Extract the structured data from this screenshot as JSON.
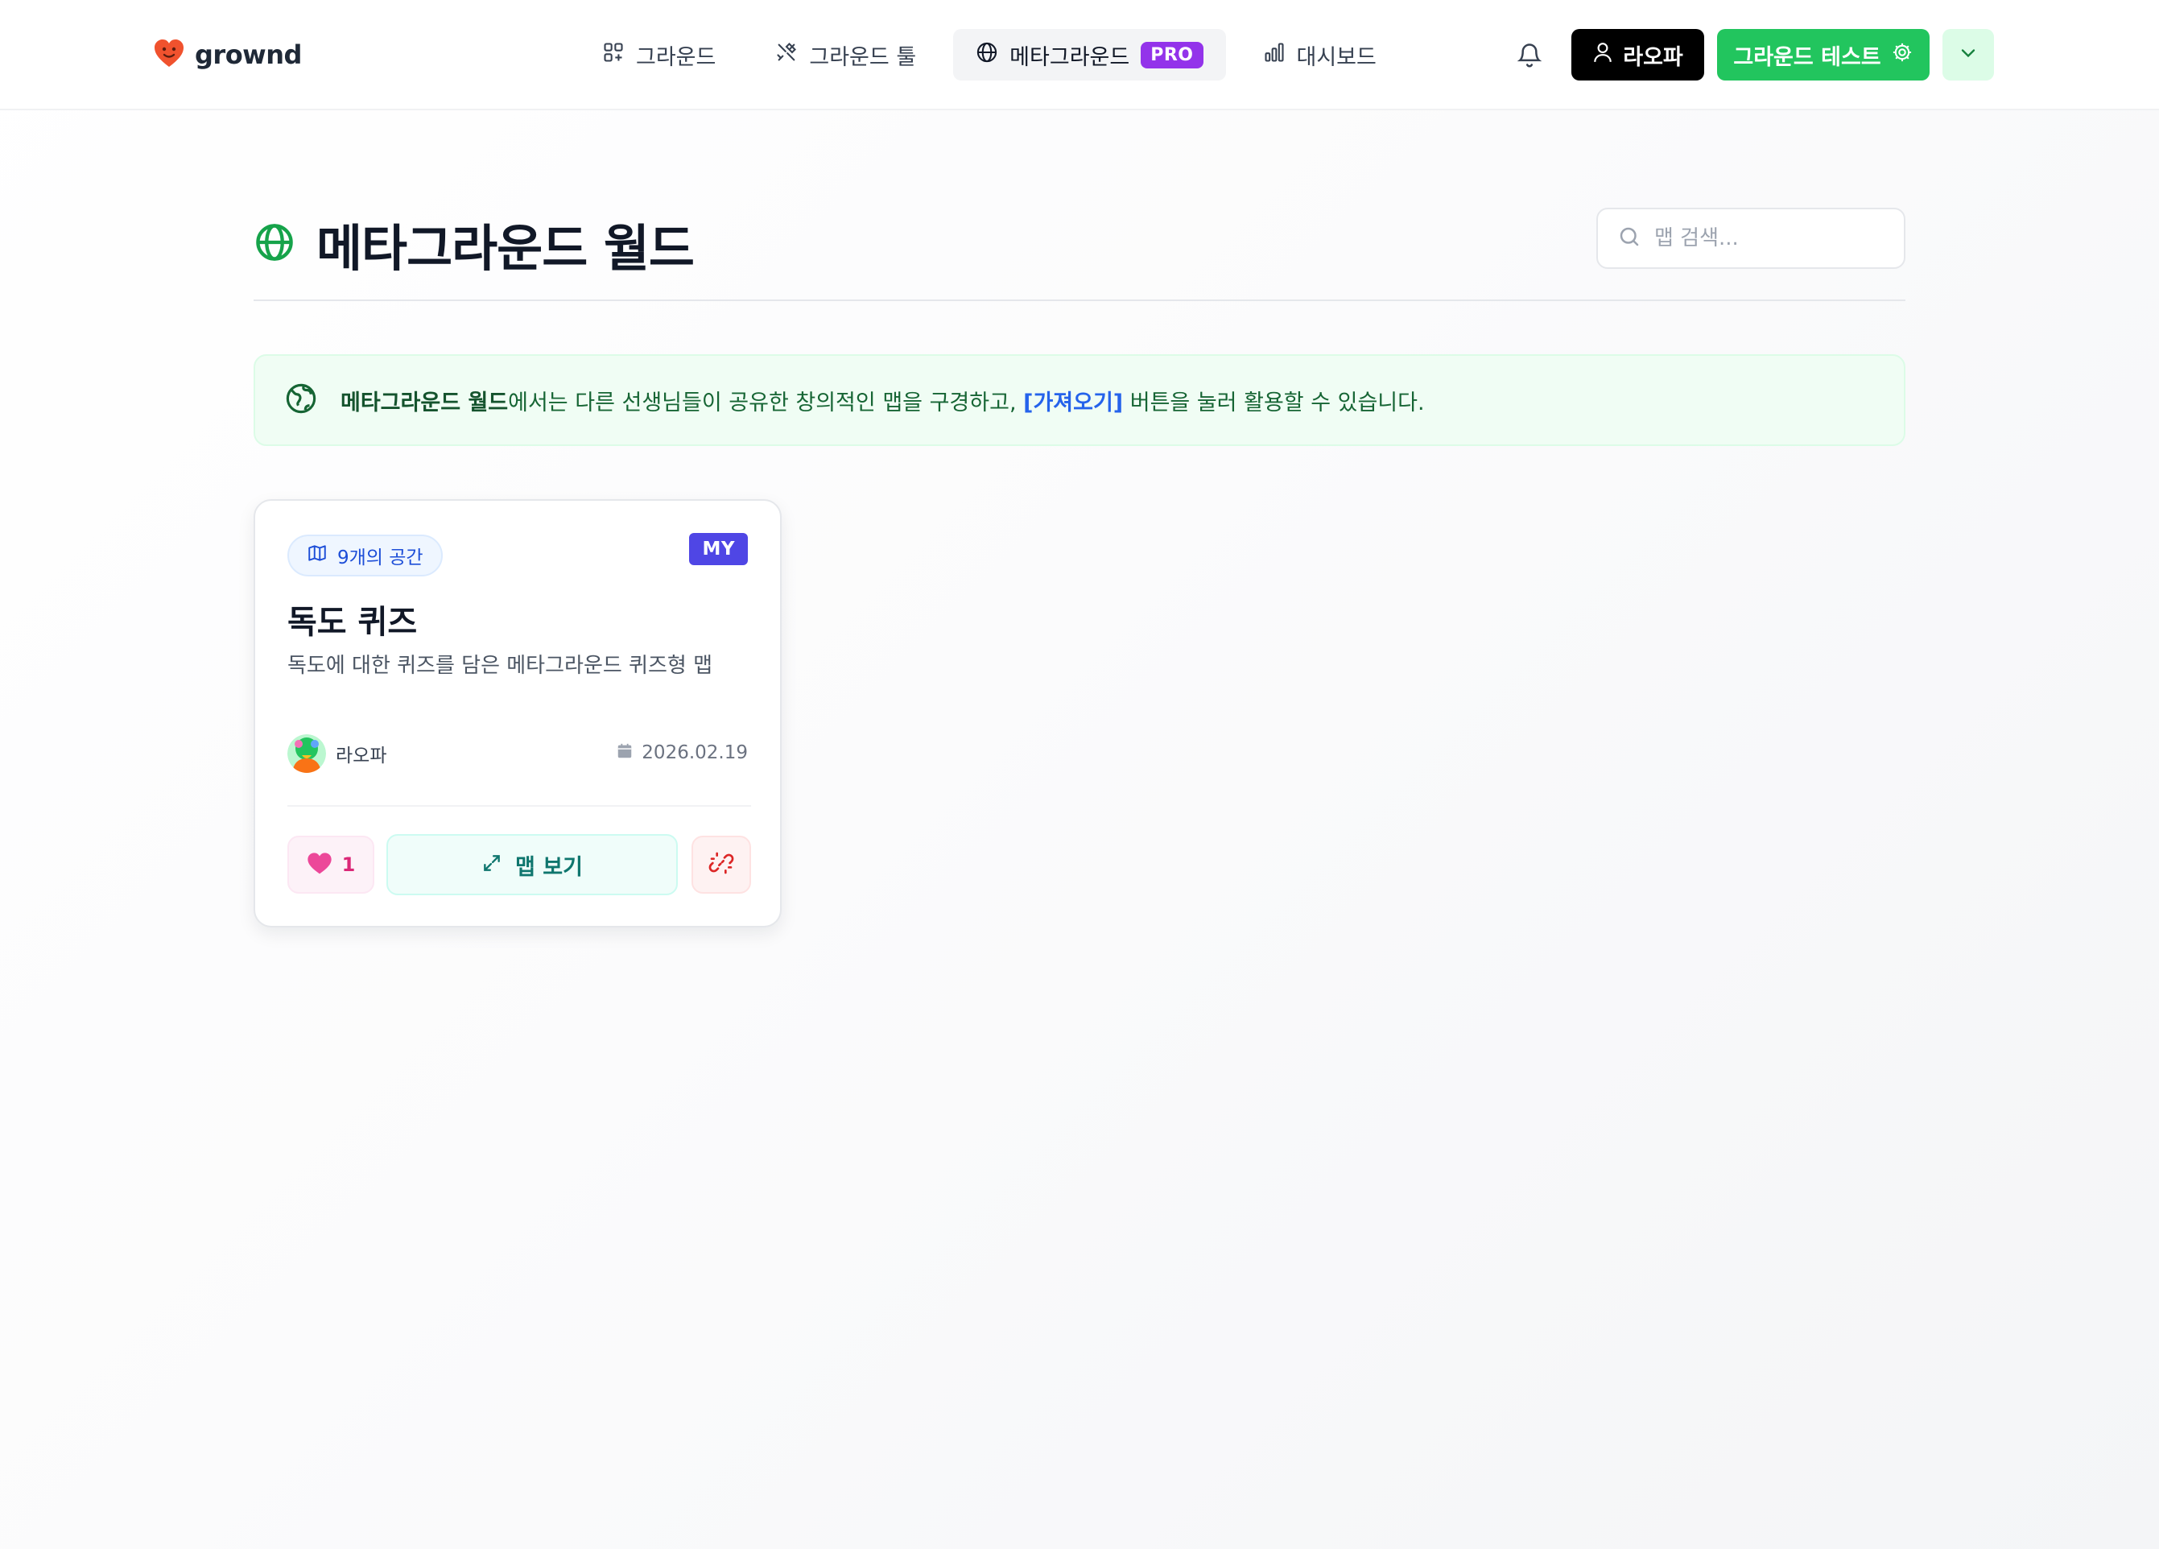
{
  "header": {
    "logo_text": "grownd",
    "nav": [
      {
        "label": "그라운드",
        "icon": "grid-icon"
      },
      {
        "label": "그라운드 툴",
        "icon": "tools-icon"
      },
      {
        "label": "메타그라운드",
        "icon": "globe-icon",
        "badge": "PRO",
        "active": true
      },
      {
        "label": "대시보드",
        "icon": "bar-chart-icon"
      }
    ],
    "user_label": "라오파",
    "test_label": "그라운드 테스트"
  },
  "page": {
    "title": "메타그라운드 월드",
    "search_placeholder": "맵 검색..."
  },
  "banner": {
    "strong": "메타그라운드 월드",
    "text1": "에서는 다른 선생님들이 공유한 창의적인 맵을 구경하고, ",
    "link": "[가져오기]",
    "text2": " 버튼을 눌러 활용할 수 있습니다."
  },
  "cards": [
    {
      "spaces": "9개의 공간",
      "badge": "MY",
      "title": "독도 퀴즈",
      "description": "독도에 대한 퀴즈를 담은 메타그라운드 퀴즈형 맵",
      "author": "라오파",
      "date": "2026.02.19",
      "likes": "1",
      "view_label": "맵 보기"
    }
  ],
  "colors": {
    "brand_green": "#22c55e",
    "pro_purple": "#9333ea",
    "my_indigo": "#4f46e5",
    "link_blue": "#2563eb",
    "like_pink": "#ec4899"
  }
}
